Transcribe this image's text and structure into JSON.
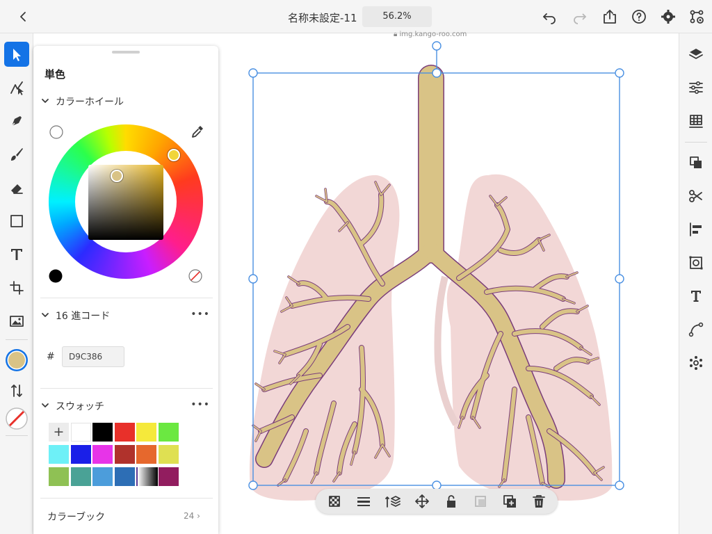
{
  "topbar": {
    "document_title": "名称未設定-11",
    "zoom": "56.2%"
  },
  "canvas": {
    "source_url": "img.kango-roo.com"
  },
  "color_panel": {
    "title": "単色",
    "wheel_section": "カラーホイール",
    "hex_section": "16 進コード",
    "hex_prefix": "#",
    "hex_value": "D9C386",
    "swatch_section": "スウォッチ",
    "more": "•••",
    "add_swatch": "+",
    "color_book": "カラーブック",
    "color_book_count": "24",
    "swatches": [
      "#ffffff",
      "#000000",
      "#e8302a",
      "#f5e93b",
      "#6be841",
      "#6ef0f7",
      "#1a1fe8",
      "#e734e8",
      "#b0322c",
      "#e6682d",
      "#dfe052",
      "#8fc154",
      "#4aa296",
      "#4c9ddb",
      "#2d6eb5",
      "#5c3a97",
      "#921d5f"
    ],
    "fill_color": "#d9c386"
  },
  "colors": {
    "accent": "#1473e6",
    "lung_tissue": "#f2d7d6",
    "bronchi": "#d9c386",
    "bronchi_outline": "#7a3d7a"
  }
}
